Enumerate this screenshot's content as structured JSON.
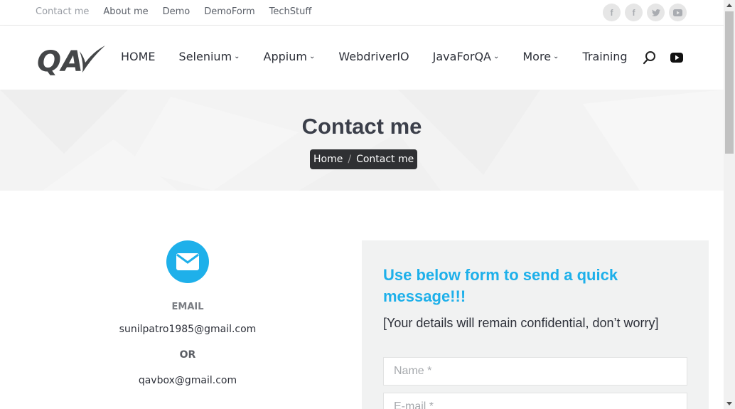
{
  "topbar": {
    "links": [
      "Contact me",
      "About me",
      "Demo",
      "DemoForm",
      "TechStuff"
    ],
    "social_icons": [
      "facebook-icon",
      "facebook-icon",
      "twitter-icon",
      "youtube-icon"
    ]
  },
  "nav": {
    "logo_text": "QAV",
    "items": [
      {
        "label": "HOME",
        "dropdown": false
      },
      {
        "label": "Selenium",
        "dropdown": true
      },
      {
        "label": "Appium",
        "dropdown": true
      },
      {
        "label": "WebdriverIO",
        "dropdown": false
      },
      {
        "label": "JavaForQA",
        "dropdown": true
      },
      {
        "label": "More",
        "dropdown": true
      },
      {
        "label": "Training",
        "dropdown": false
      }
    ]
  },
  "hero": {
    "title": "Contact me",
    "breadcrumb": {
      "home": "Home",
      "sep": "/",
      "current": "Contact me"
    }
  },
  "contact": {
    "email_label": "EMAIL",
    "email1": "sunilpatro1985@gmail.com",
    "or_text": "OR",
    "email2": "qavbox@gmail.com"
  },
  "form": {
    "title": "Use below form to send a quick message!!!",
    "subtitle": "[Your details will remain confidential, don’t worry]",
    "name_placeholder": "Name *",
    "email_placeholder": "E-mail *"
  },
  "colors": {
    "accent": "#1eb0ea",
    "crumb_bg": "#2f3033",
    "hero_bg": "#f3f3f3",
    "form_bg": "#f1f2f2"
  }
}
